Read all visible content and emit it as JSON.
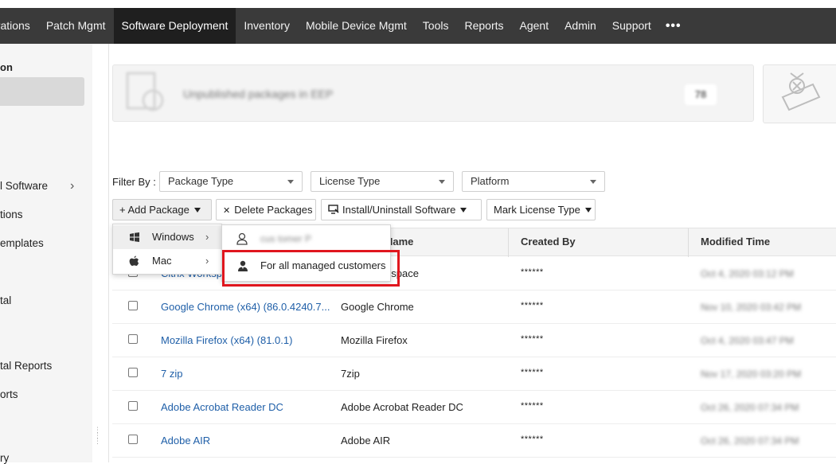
{
  "nav": {
    "items": [
      "urations",
      "Patch Mgmt",
      "Software Deployment",
      "Inventory",
      "Mobile Device Mgmt",
      "Tools",
      "Reports",
      "Agent",
      "Admin",
      "Support"
    ],
    "more": "•••"
  },
  "sidebar": {
    "heading": "on",
    "items": [
      "l Software",
      "tions",
      "emplates",
      "tal",
      "tal Reports",
      "orts",
      "ry"
    ]
  },
  "banner": {
    "text": "Unpublished packages in EEP",
    "count": "78"
  },
  "filters": {
    "label": "Filter By :",
    "package_type": "Package Type",
    "license_type": "License Type",
    "platform": "Platform"
  },
  "toolbar": {
    "add_package": "+ Add Package",
    "delete_packages": "Delete Packages",
    "install_uninstall": "Install/Uninstall Software",
    "mark_license": "Mark License Type"
  },
  "table": {
    "headers": [
      "Name",
      "Created By",
      "Modified Time"
    ],
    "rows": [
      {
        "pkg": "Citrix Workspace",
        "sw": "Citrix Workspace",
        "by": "******",
        "mod": "Oct 4, 2020 03:12 PM"
      },
      {
        "pkg": "Google Chrome (x64) (86.0.4240.7...",
        "sw": "Google Chrome",
        "by": "******",
        "mod": "Nov 10, 2020 03:42 PM"
      },
      {
        "pkg": "Mozilla Firefox (x64) (81.0.1)",
        "sw": "Mozilla Firefox",
        "by": "******",
        "mod": "Oct 4, 2020 03:47 PM"
      },
      {
        "pkg": "7 zip",
        "sw": "7zip",
        "by": "******",
        "mod": "Nov 17, 2020 03:20 PM"
      },
      {
        "pkg": "Adobe Acrobat Reader DC",
        "sw": "Adobe Acrobat Reader DC",
        "by": "******",
        "mod": "Oct 26, 2020 07:34 PM"
      },
      {
        "pkg": "Adobe AIR",
        "sw": "Adobe AIR",
        "by": "******",
        "mod": "Oct 26, 2020 07:34 PM"
      }
    ]
  },
  "add_menu": {
    "windows": "Windows",
    "mac": "Mac"
  },
  "submenu": {
    "blurred_customer": "cus tomer P",
    "all_customers": "For all managed customers"
  },
  "colors": {
    "nav_bg": "#3a3a3a",
    "nav_active": "#1f1f1f",
    "link": "#1f5fa8",
    "highlight": "#e0161e"
  }
}
